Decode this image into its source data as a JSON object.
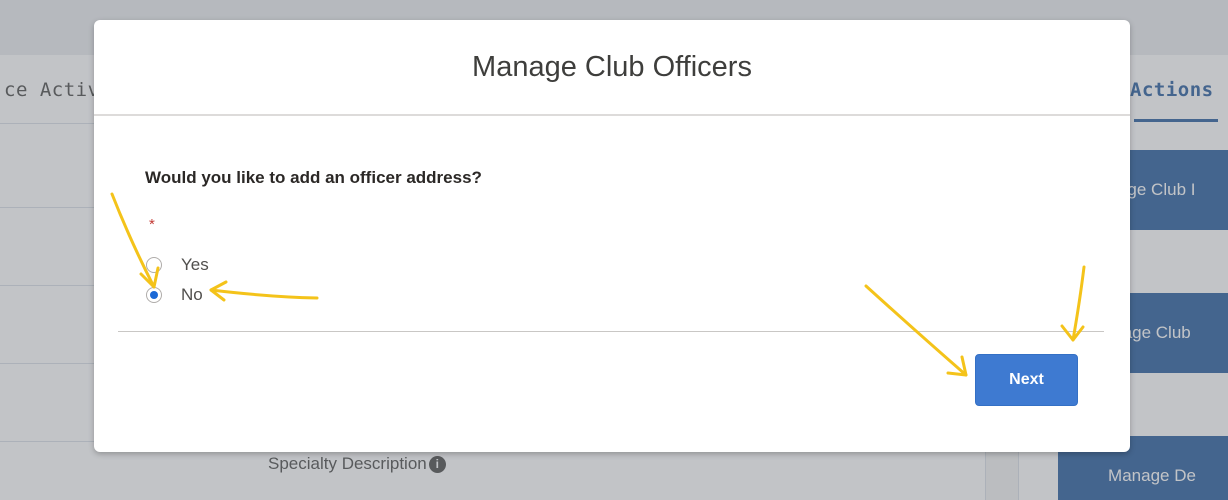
{
  "background": {
    "left_tab_label": "ce Activ",
    "right_tab_label": "Actions",
    "action_buttons": [
      "nage Club I",
      "nage Club",
      "Manage De"
    ],
    "specialty_label": "Specialty Description",
    "info_icon_glyph": "i"
  },
  "modal": {
    "title": "Manage Club Officers",
    "question": "Would you like to add an officer address?",
    "required_mark": "*",
    "options": [
      {
        "label": "Yes",
        "checked": false
      },
      {
        "label": "No",
        "checked": true
      }
    ],
    "next_label": "Next"
  },
  "colors": {
    "accent": "#3e7ad1",
    "navy": "#1b5297",
    "radio_selected": "#1b69d6",
    "required": "#c23934",
    "annotation_arrow": "#f4c31a"
  }
}
